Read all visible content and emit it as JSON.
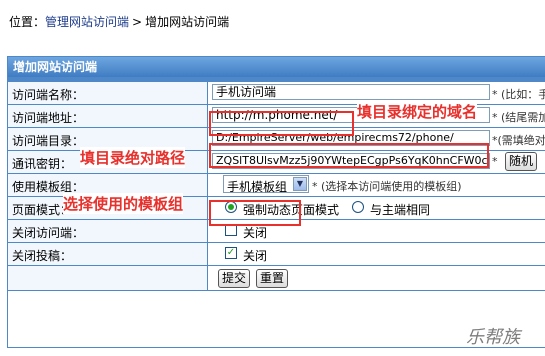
{
  "breadcrumb": {
    "prefix": "位置：",
    "link": "管理网站访问端",
    "separator": ">",
    "current": "增加网站访问端"
  },
  "panel": {
    "title": "增加网站访问端"
  },
  "form": {
    "name": {
      "label": "访问端名称：",
      "value": "手机访问端",
      "hint": "* (比如：手"
    },
    "url": {
      "label": "访问端地址：",
      "value": "http://m.phome.net/",
      "hint": "* (结尾需加"
    },
    "dir": {
      "label": "访问端目录：",
      "value": "D:/EmpireServer/web/empirecms72/phone/",
      "hint": "*(需填绝对"
    },
    "key": {
      "label": "通讯密钥：",
      "value": "ZQSlT8UlsvMzz5j90YWtepECgpPs6YqK0hnCFW0c",
      "random": "随机"
    },
    "template": {
      "label": "使用模板组：",
      "value": "手机模板组",
      "hint": "* (选择本访问端使用的模板组)"
    },
    "mode": {
      "label": "页面模式：",
      "option1": "强制动态页面模式",
      "option2": "与主端相同",
      "selected": 1
    },
    "close_access": {
      "label": "关闭访问端：",
      "option": "关闭",
      "checked": false
    },
    "close_submit": {
      "label": "关闭投稿：",
      "option": "关闭",
      "checked": true
    },
    "buttons": {
      "submit": "提交",
      "reset": "重置"
    }
  },
  "annotations": {
    "domain": "填目录绑定的域名",
    "path": "填目录绝对路径",
    "template": "选择使用的模板组"
  },
  "watermark": "乐帮族",
  "colors": {
    "header_bg": "#4f88c8",
    "label_bg": "#f2f7fd",
    "annotation": "#e8302c",
    "link": "#1e3c8c"
  }
}
